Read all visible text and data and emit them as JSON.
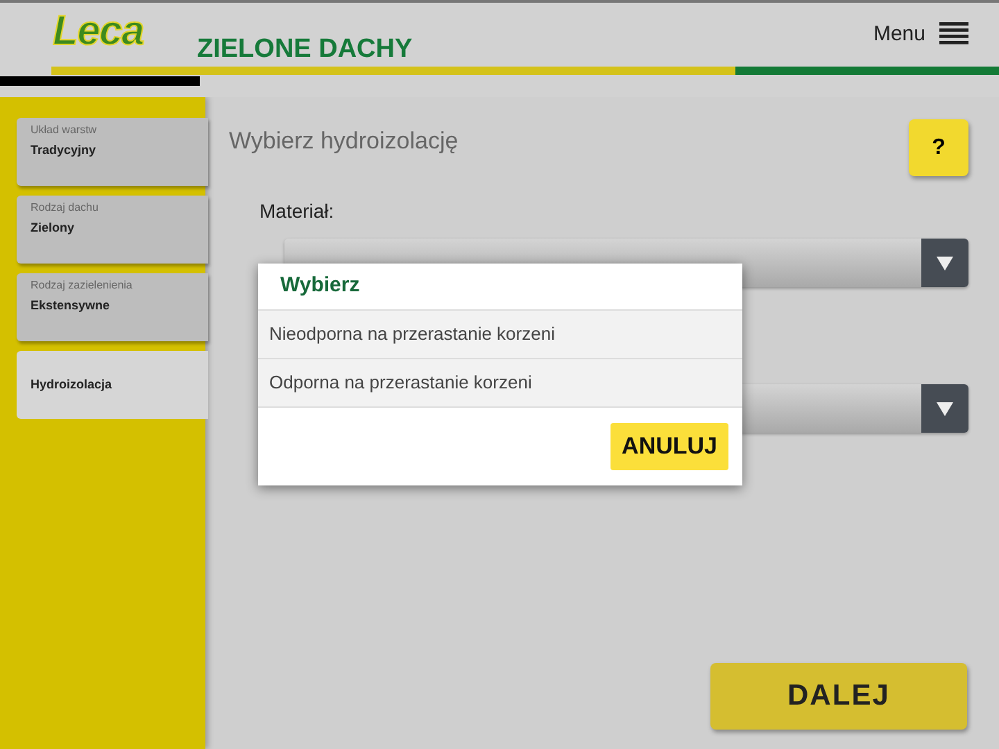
{
  "header": {
    "logo": "Leca",
    "title": "ZIELONE DACHY",
    "menu_label": "Menu",
    "progress": {
      "level": 0.2
    }
  },
  "steps": [
    {
      "caption": "Układ warstw",
      "value": "Tradycyjny",
      "selected": false
    },
    {
      "caption": "Rodzaj dachu",
      "value": "Zielony",
      "selected": false
    },
    {
      "caption": "Rodzaj zazielenienia",
      "value": "Ekstensywne",
      "selected": false
    },
    {
      "value": "Hydroizolacja",
      "selected": true
    }
  ],
  "main": {
    "heading": "Wybierz hydroizolację",
    "help": "?",
    "fields": [
      {
        "label": "Materiał:",
        "kind": "dropdown"
      },
      {
        "kind": "dropdown"
      }
    ],
    "next_button": "DALEJ"
  },
  "dialog": {
    "title": "Wybierz",
    "options": [
      "Nieodporna na przerastanie korzeni",
      "Odporna na przerastanie korzeni"
    ],
    "cancel": "ANULUJ"
  }
}
